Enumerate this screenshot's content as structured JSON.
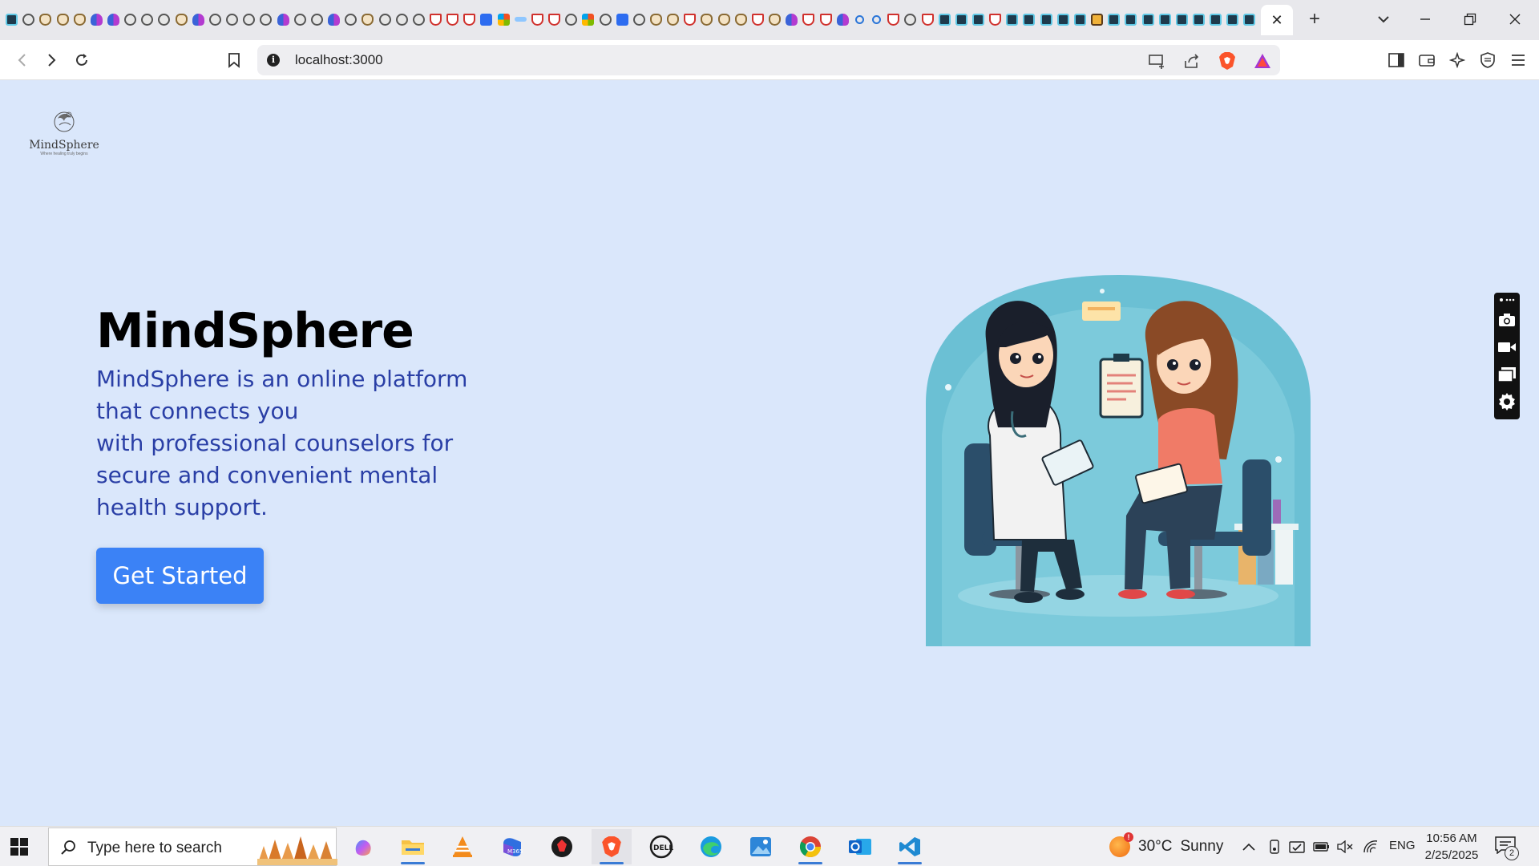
{
  "browser": {
    "tabs_favicons": [
      "react",
      "globe",
      "guard",
      "guard",
      "guard",
      "butterfly",
      "butterfly",
      "globe",
      "globe",
      "globe",
      "guard",
      "butterfly",
      "globe",
      "globe",
      "globe",
      "globe",
      "butterfly",
      "globe",
      "globe",
      "butterfly",
      "globe",
      "guard",
      "globe",
      "globe",
      "globe",
      "shield",
      "shield",
      "shield",
      "zm",
      "ms",
      "keep",
      "shield",
      "shield",
      "globe",
      "ms",
      "globe",
      "zm",
      "globe",
      "guard",
      "guard",
      "shield",
      "guard",
      "guard",
      "guard",
      "shield",
      "guard",
      "butterfly",
      "shield",
      "shield",
      "butterfly",
      "search",
      "search",
      "shield",
      "globe",
      "shield",
      "react",
      "react",
      "react",
      "shield",
      "react",
      "react",
      "react",
      "react",
      "react",
      "bio",
      "react",
      "react",
      "react",
      "react",
      "react",
      "react",
      "react",
      "react",
      "react"
    ],
    "active_tab_close": "✕",
    "new_tab_label": "+",
    "window_controls": {
      "minimize": "—",
      "restore": "❐",
      "close": "✕"
    },
    "address": "localhost:3000"
  },
  "page": {
    "logo": {
      "name": "MindSphere",
      "tagline": "Where healing truly begins"
    },
    "hero": {
      "title": "MindSphere",
      "description_lines": [
        "MindSphere is an online platform",
        "that connects you",
        "with professional counselors for",
        "secure and convenient mental",
        "health support."
      ],
      "cta_label": "Get Started"
    },
    "illustration_alt": "counselor-session-illustration"
  },
  "taskbar": {
    "search_placeholder": "Type here to search",
    "apps": [
      "copilot",
      "file-explorer",
      "vlc",
      "m365",
      "app-red",
      "brave",
      "dell",
      "edge",
      "photos",
      "chrome",
      "outlook",
      "vscode"
    ],
    "weather": {
      "temp": "30°C",
      "condition": "Sunny",
      "badge": "!"
    },
    "language": "ENG",
    "time": "10:56 AM",
    "date": "2/25/2025",
    "notification_count": "2"
  },
  "colors": {
    "page_bg": "#dae7fb",
    "hero_text": "#2a3fa6",
    "cta_bg": "#3b82f6",
    "brave_orange": "#fb542b"
  }
}
